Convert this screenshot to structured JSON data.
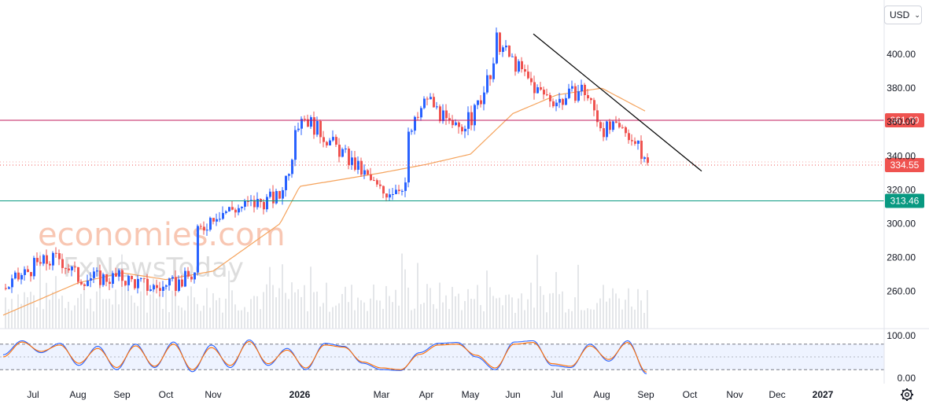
{
  "watermark": {
    "line1": "economies.com",
    "line2": "FxNewsToday"
  },
  "currency_selector": {
    "value": "USD",
    "icon": "chevron-down-icon"
  },
  "settings_icon": "gear-icon",
  "colors": {
    "up": "#2962ff",
    "down": "#ef5350",
    "ma": "#f5a35c",
    "resistance": "#ef5350",
    "support": "#089981",
    "trendline": "#000000",
    "stoch_k": "#2962ff",
    "stoch_d": "#ff6d00",
    "watermark": "#f6b49a"
  },
  "chart_data": [
    {
      "type": "candlestick",
      "panel": "price",
      "ylim": [
        245,
        418
      ],
      "y_ticks": [
        "260.00",
        "280.00",
        "300.00",
        "320.00",
        "340.00",
        "360.00",
        "380.00",
        "400.00"
      ],
      "x_labels": [
        "Jul",
        "Aug",
        "Sep",
        "Oct",
        "Nov",
        "2026",
        "Mar",
        "Apr",
        "May",
        "Jun",
        "Jul",
        "Aug",
        "Sep",
        "Oct",
        "Nov",
        "Dec",
        "2027"
      ],
      "close_path": [
        [
          "Jul",
          262
        ],
        [
          "Jul",
          275
        ],
        [
          "Aug",
          280
        ],
        [
          "Aug",
          268
        ],
        [
          "Sep",
          268
        ],
        [
          "Oct",
          263
        ],
        [
          "Oct",
          262
        ],
        [
          "Nov",
          270
        ],
        [
          "Nov",
          292
        ],
        [
          "Nov",
          306
        ],
        [
          "2026",
          316
        ],
        [
          "2026",
          312
        ],
        [
          "2026",
          330
        ],
        [
          "2026",
          365
        ],
        [
          "Mar",
          330
        ],
        [
          "Mar",
          318
        ],
        [
          "Apr",
          325
        ],
        [
          "Apr",
          350
        ],
        [
          "Apr",
          375
        ],
        [
          "May",
          355
        ],
        [
          "May",
          362
        ],
        [
          "Jun",
          392
        ],
        [
          "Jun",
          410
        ],
        [
          "Jun",
          395
        ],
        [
          "Jul",
          378
        ],
        [
          "Jul",
          372
        ],
        [
          "Aug",
          380
        ],
        [
          "Aug",
          380
        ],
        [
          "Aug",
          356
        ],
        [
          "Sep",
          355
        ],
        [
          "Sep",
          334.55
        ]
      ],
      "moving_average_path": [
        [
          "Jul",
          246
        ],
        [
          "Aug",
          265
        ],
        [
          "Sep",
          271
        ],
        [
          "Oct",
          267
        ],
        [
          "Nov",
          272
        ],
        [
          "2026",
          300
        ],
        [
          "2026",
          322
        ],
        [
          "Mar",
          330
        ],
        [
          "Apr",
          335
        ],
        [
          "May",
          341
        ],
        [
          "Jun",
          365
        ],
        [
          "Jul",
          376
        ],
        [
          "Aug",
          380
        ],
        [
          "Sep",
          366
        ]
      ],
      "last_price": "334.55",
      "horizontal_lines": [
        {
          "label": "361.00",
          "value": 361.0,
          "role": "resistance"
        },
        {
          "label": "313.46",
          "value": 313.46,
          "role": "support"
        }
      ],
      "trendline": {
        "from": [
          "Jun",
          412
        ],
        "to": [
          "Oct",
          331
        ]
      },
      "volume": "present"
    },
    {
      "type": "line",
      "panel": "stochastic",
      "ylim": [
        0,
        100
      ],
      "y_ticks": [
        "0.00",
        "100.00"
      ],
      "band": [
        20,
        80
      ],
      "series": [
        {
          "values": [
            55,
            88,
            60,
            82,
            30,
            75,
            20,
            80,
            25,
            85,
            15,
            78,
            25,
            90,
            30,
            70,
            20,
            82,
            75,
            35,
            20,
            18,
            60,
            82,
            84,
            50,
            20,
            85,
            88,
            30,
            25,
            80,
            40,
            88,
            10
          ]
        },
        {
          "values": [
            50,
            85,
            63,
            78,
            35,
            70,
            25,
            76,
            28,
            80,
            20,
            72,
            30,
            86,
            34,
            66,
            24,
            78,
            73,
            38,
            24,
            20,
            56,
            78,
            80,
            54,
            24,
            80,
            84,
            34,
            28,
            76,
            44,
            84,
            14
          ]
        }
      ]
    }
  ]
}
